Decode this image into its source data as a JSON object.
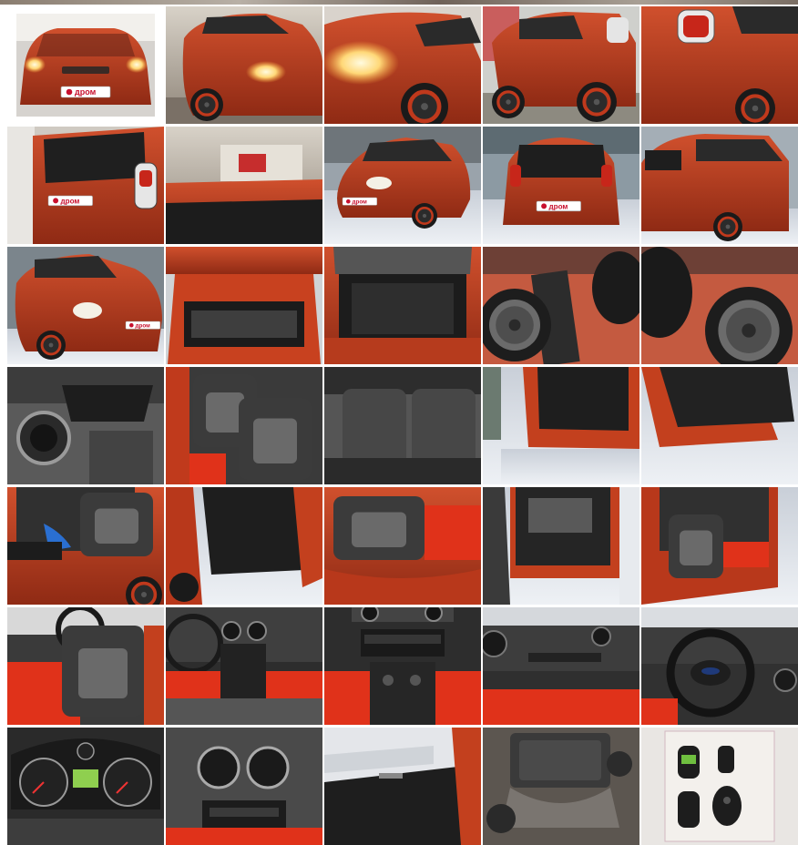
{
  "gallery": {
    "selected_index": 0,
    "columns": 5,
    "rows": 7,
    "watermark": "дром",
    "photos": [
      {
        "id": 1,
        "subject": "front-headlights"
      },
      {
        "id": 2,
        "subject": "front-left-side"
      },
      {
        "id": 3,
        "subject": "headlight-closeup"
      },
      {
        "id": 4,
        "subject": "rear-left-side"
      },
      {
        "id": 5,
        "subject": "rear-taillight"
      },
      {
        "id": 6,
        "subject": "rear-closeup"
      },
      {
        "id": 7,
        "subject": "roof-in-garage"
      },
      {
        "id": 8,
        "subject": "front-snow"
      },
      {
        "id": 9,
        "subject": "rear-snow"
      },
      {
        "id": 10,
        "subject": "rear-side-snow"
      },
      {
        "id": 11,
        "subject": "front-left-snow"
      },
      {
        "id": 12,
        "subject": "open-tailgate"
      },
      {
        "id": 13,
        "subject": "trunk"
      },
      {
        "id": 14,
        "subject": "spare-wheel"
      },
      {
        "id": 15,
        "subject": "spare-wheel-well"
      },
      {
        "id": 16,
        "subject": "dashboard-vent"
      },
      {
        "id": 17,
        "subject": "driver-seat"
      },
      {
        "id": 18,
        "subject": "rear-seats"
      },
      {
        "id": 19,
        "subject": "rear-door-open"
      },
      {
        "id": 20,
        "subject": "rear-door-panel"
      },
      {
        "id": 21,
        "subject": "rear-floor"
      },
      {
        "id": 22,
        "subject": "rear-door-inside"
      },
      {
        "id": 23,
        "subject": "rear-seat-mat"
      },
      {
        "id": 24,
        "subject": "front-door-open"
      },
      {
        "id": 25,
        "subject": "front-seat-mat"
      },
      {
        "id": 26,
        "subject": "front-interior"
      },
      {
        "id": 27,
        "subject": "center-console"
      },
      {
        "id": 28,
        "subject": "radio-console"
      },
      {
        "id": 29,
        "subject": "passenger-dashboard"
      },
      {
        "id": 30,
        "subject": "steering-wheel"
      },
      {
        "id": 31,
        "subject": "instrument-cluster"
      },
      {
        "id": 32,
        "subject": "center-vents"
      },
      {
        "id": 33,
        "subject": "window-view"
      },
      {
        "id": 34,
        "subject": "engine"
      },
      {
        "id": 35,
        "subject": "keys-documents"
      }
    ]
  },
  "colors": {
    "car_red": "#b93a1f",
    "car_red_dark": "#7f2512",
    "snow": "#e6e9ee",
    "interior": "#3a3a3a",
    "floor_mat": "#e0321a"
  }
}
